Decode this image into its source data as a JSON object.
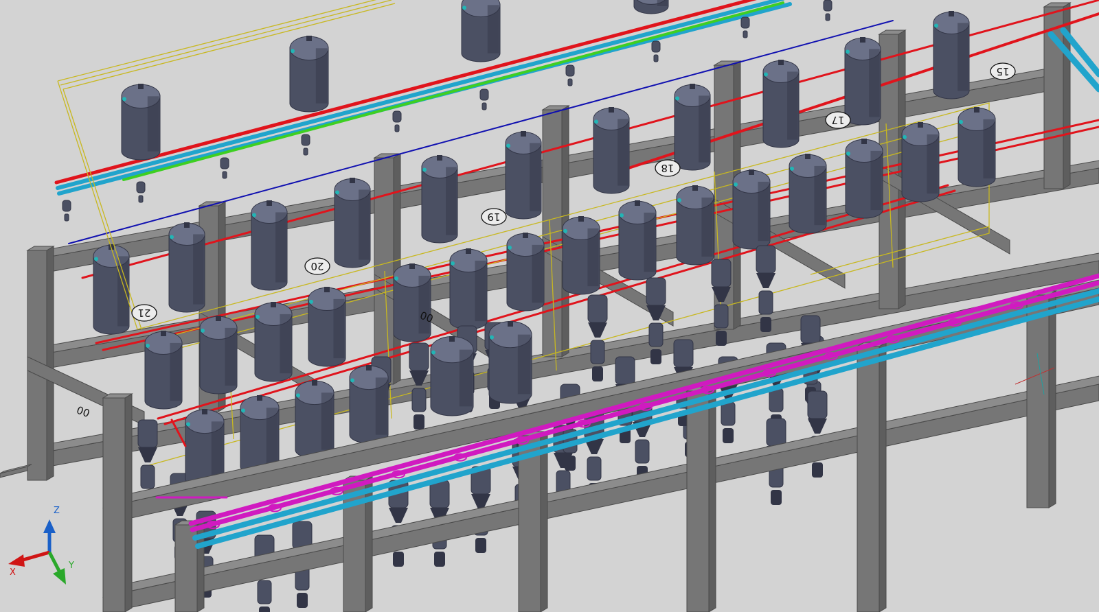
{
  "viewport": {
    "name": "3D piping model view (isometric)",
    "background": "#d3d3d3"
  },
  "colors": {
    "frame_top": "#8c8c8c",
    "frame_side": "#5e5e5e",
    "frame_front": "#767676",
    "vessel_body": "#4b5063",
    "vessel_dark": "#323546",
    "vessel_light": "#6b7188",
    "pipe_red": "#e0141c",
    "pipe_blue": "#1010b0",
    "pipe_cyan": "#21a4cc",
    "pipe_green": "#3ecf22",
    "pipe_magenta": "#d01ac0",
    "pipe_yellow": "#c8b820",
    "valve_cyan": "#22b5b5"
  },
  "axis_labels": [
    "15",
    "17",
    "18",
    "19",
    "20",
    "21"
  ],
  "partial_labels": [
    "00"
  ],
  "ucs_icon": {
    "x": "X",
    "y": "Y",
    "z": "Z"
  }
}
